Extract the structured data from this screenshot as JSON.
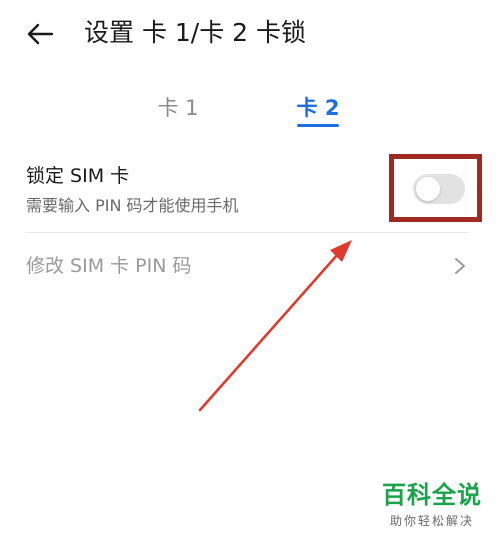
{
  "header": {
    "back_icon": "arrow-left-icon",
    "title": "设置 卡 1/卡 2 卡锁"
  },
  "tabs": [
    {
      "label": "卡 1",
      "selected": false
    },
    {
      "label": "卡 2",
      "selected": true
    }
  ],
  "lock_sim": {
    "title": "锁定 SIM 卡",
    "subtitle": "需要输入 PIN 码才能使用手机",
    "toggle_on": false
  },
  "change_pin": {
    "label": "修改 SIM 卡 PIN 码",
    "chevron_icon": "chevron-right-icon"
  },
  "annotation": {
    "box_color": "#a02a22",
    "arrow_color": "#e03a2c"
  },
  "watermark": {
    "title": "百科全说",
    "subtitle": "助你轻松解决"
  },
  "colors": {
    "accent": "#1d6fe0",
    "brand_green": "#1aa34a"
  }
}
